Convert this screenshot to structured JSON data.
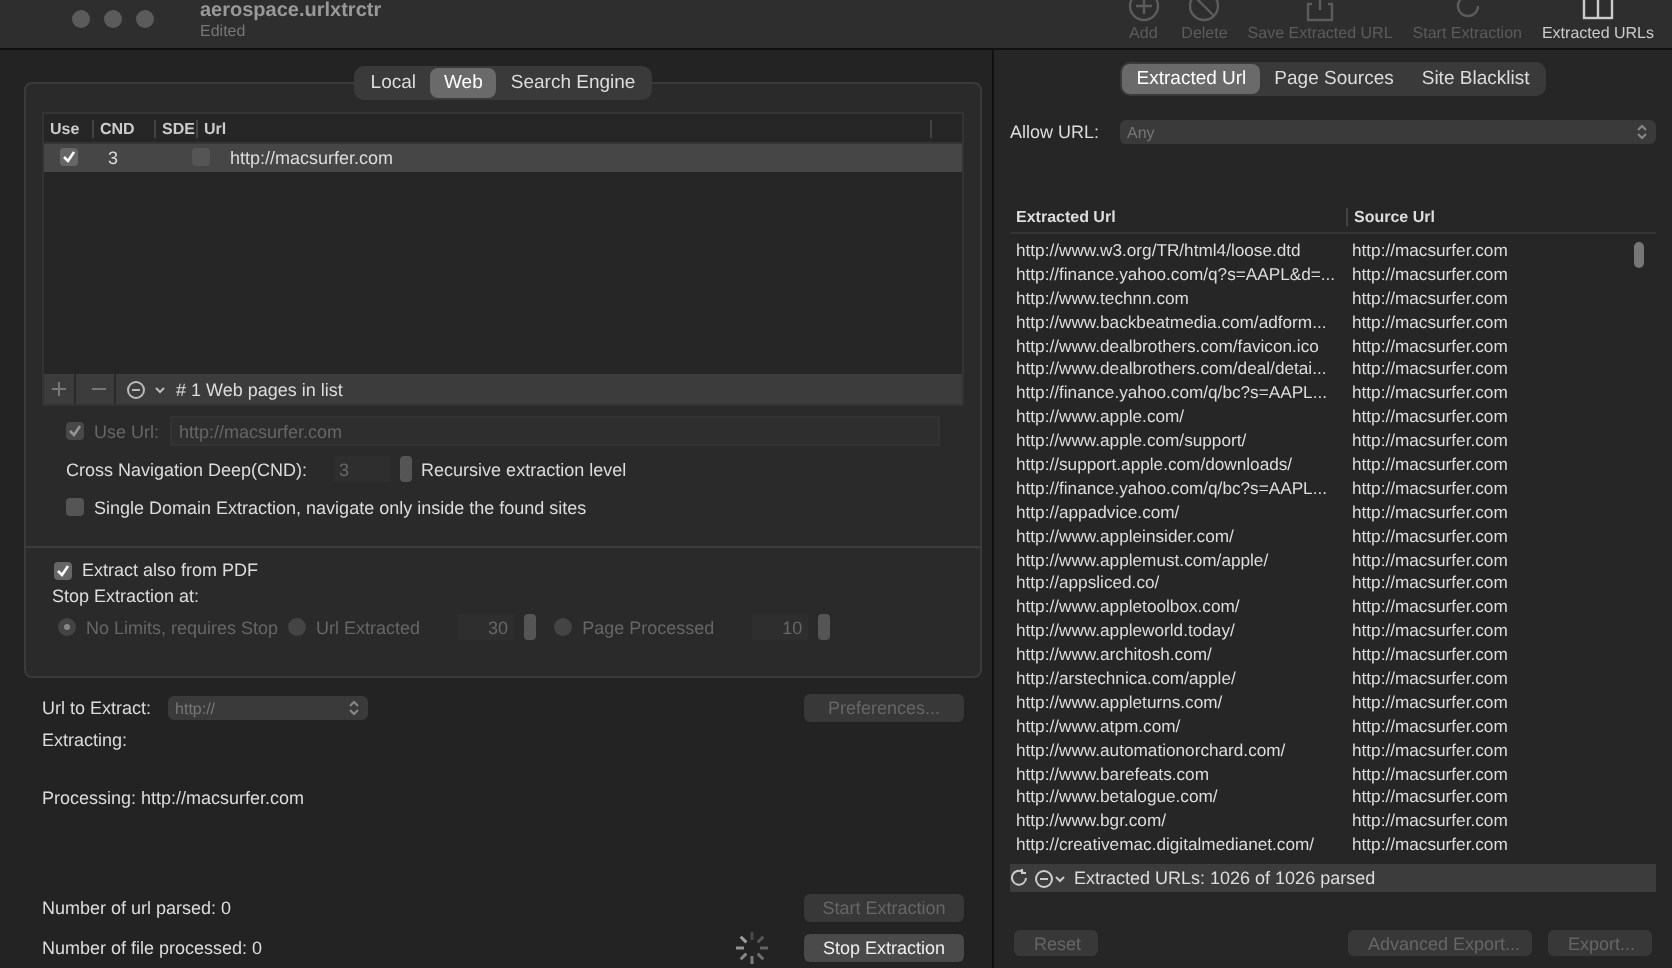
{
  "window": {
    "title": "aerospace.urlxtrctr",
    "subtitle": "Edited"
  },
  "toolbar": [
    {
      "kind": "add",
      "label": "Add",
      "disabled": true
    },
    {
      "kind": "delete",
      "label": "Delete",
      "disabled": true
    },
    {
      "kind": "save",
      "label": "Save Extracted URL",
      "disabled": true
    },
    {
      "kind": "start",
      "label": "Start Extraction",
      "disabled": true
    },
    {
      "kind": "panel",
      "label": "Extracted URLs",
      "disabled": false
    }
  ],
  "left": {
    "tabs": [
      {
        "label": "Local",
        "selected": false
      },
      {
        "label": "Web",
        "selected": true
      },
      {
        "label": "Search Engine",
        "selected": false
      }
    ],
    "url_table": {
      "columns": [
        "Use",
        "CND",
        "SDE",
        "Url"
      ],
      "rows": [
        {
          "use": true,
          "cnd": "3",
          "sde": false,
          "url": "http://macsurfer.com",
          "selected": true
        }
      ],
      "footer": "# 1 Web pages in list"
    },
    "use_url": {
      "label": "Use Url:",
      "checked": true,
      "value": "http://macsurfer.com"
    },
    "cnd": {
      "label": "Cross Navigation Deep(CND):",
      "value": "3",
      "note": "Recursive extraction level"
    },
    "single_domain": {
      "label": "Single Domain Extraction, navigate only inside the found sites",
      "checked": false
    },
    "extract_pdf": {
      "label": "Extract also from PDF",
      "checked": true
    },
    "stop_label": "Stop Extraction at:",
    "stop_options": [
      {
        "label": "No Limits, requires Stop",
        "selected": true
      },
      {
        "label": "Url Extracted",
        "selected": false,
        "value": "30"
      },
      {
        "label": "Page Processed",
        "selected": false,
        "value": "10"
      }
    ],
    "url_to_extract": {
      "label": "Url to Extract:",
      "placeholder": "http://"
    },
    "preferences": {
      "label": "Preferences...",
      "disabled": true
    },
    "extracting": "Extracting:",
    "processing": "Processing: http://macsurfer.com",
    "url_parsed": "Number of url parsed: 0",
    "file_processed": "Number of file processed: 0",
    "start": {
      "label": "Start Extraction",
      "disabled": true
    },
    "stop": {
      "label": "Stop Extraction",
      "disabled": false
    }
  },
  "right": {
    "tabs": [
      {
        "label": "Extracted Url",
        "selected": true
      },
      {
        "label": "Page Sources",
        "selected": false
      },
      {
        "label": "Site Blacklist",
        "selected": false
      }
    ],
    "allow_url": {
      "label": "Allow URL:",
      "value": "Any"
    },
    "columns": [
      "Extracted Url",
      "Source Url"
    ],
    "rows": [
      [
        "http://www.w3.org/TR/html4/loose.dtd",
        "http://macsurfer.com"
      ],
      [
        "http://finance.yahoo.com/q?s=AAPL&d=...",
        "http://macsurfer.com"
      ],
      [
        "http://www.technn.com",
        "http://macsurfer.com"
      ],
      [
        "http://www.backbeatmedia.com/adform...",
        "http://macsurfer.com"
      ],
      [
        "http://www.dealbrothers.com/favicon.ico",
        "http://macsurfer.com"
      ],
      [
        "http://www.dealbrothers.com/deal/detai...",
        "http://macsurfer.com"
      ],
      [
        "http://finance.yahoo.com/q/bc?s=AAPL...",
        "http://macsurfer.com"
      ],
      [
        "http://www.apple.com/",
        "http://macsurfer.com"
      ],
      [
        "http://www.apple.com/support/",
        "http://macsurfer.com"
      ],
      [
        "http://support.apple.com/downloads/",
        "http://macsurfer.com"
      ],
      [
        "http://finance.yahoo.com/q/bc?s=AAPL...",
        "http://macsurfer.com"
      ],
      [
        "http://appadvice.com/",
        "http://macsurfer.com"
      ],
      [
        "http://www.appleinsider.com/",
        "http://macsurfer.com"
      ],
      [
        "http://www.applemust.com/apple/",
        "http://macsurfer.com"
      ],
      [
        "http://appsliced.co/",
        "http://macsurfer.com"
      ],
      [
        "http://www.appletoolbox.com/",
        "http://macsurfer.com"
      ],
      [
        "http://www.appleworld.today/",
        "http://macsurfer.com"
      ],
      [
        "http://www.architosh.com/",
        "http://macsurfer.com"
      ],
      [
        "http://arstechnica.com/apple/",
        "http://macsurfer.com"
      ],
      [
        "http://www.appleturns.com/",
        "http://macsurfer.com"
      ],
      [
        "http://www.atpm.com/",
        "http://macsurfer.com"
      ],
      [
        "http://www.automationorchard.com/",
        "http://macsurfer.com"
      ],
      [
        "http://www.barefeats.com",
        "http://macsurfer.com"
      ],
      [
        "http://www.betalogue.com/",
        "http://macsurfer.com"
      ],
      [
        "http://www.bgr.com/",
        "http://macsurfer.com"
      ],
      [
        "http://creativemac.digitalmedianet.com/",
        "http://macsurfer.com"
      ]
    ],
    "footer": "Extracted URLs: 1026 of  1026 parsed",
    "buttons": [
      {
        "label": "Reset",
        "disabled": true
      },
      {
        "label": "Advanced Export...",
        "disabled": true
      },
      {
        "label": "Export...",
        "disabled": true
      }
    ]
  }
}
